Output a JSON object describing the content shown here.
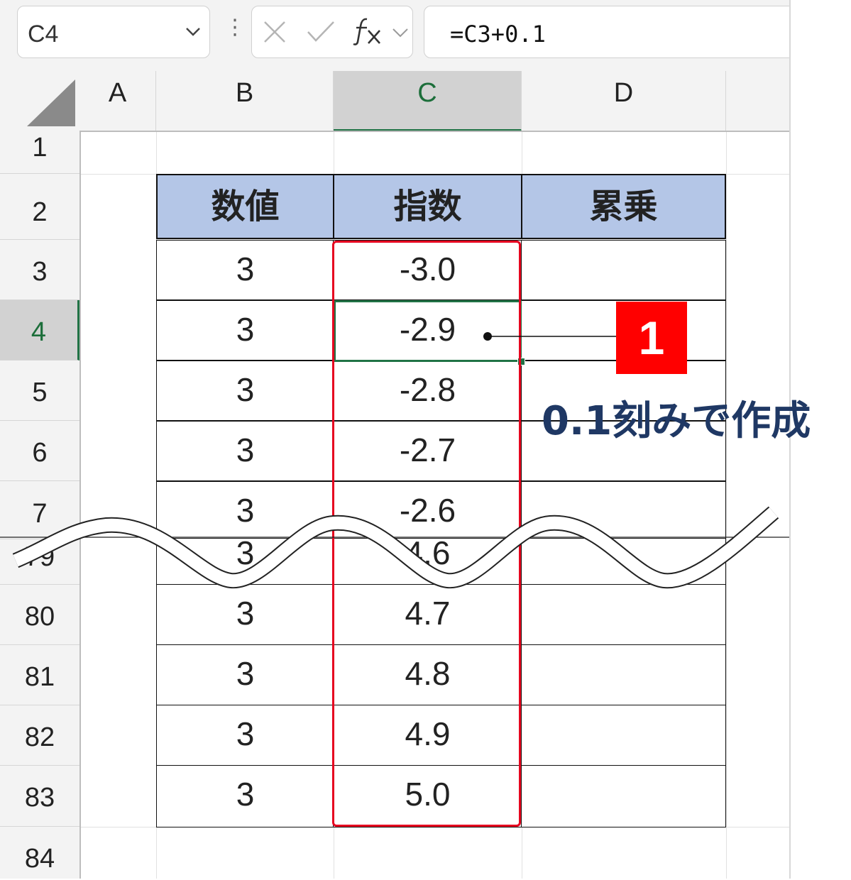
{
  "formula_bar": {
    "name_box": "C4",
    "formula": "=C3+0.1"
  },
  "columns": [
    "A",
    "B",
    "C",
    "D"
  ],
  "rows": [
    "1",
    "2",
    "3",
    "4",
    "5",
    "6",
    "7",
    "79",
    "80",
    "81",
    "82",
    "83",
    "84"
  ],
  "table": {
    "headers": [
      "数値",
      "指数",
      "累乗"
    ],
    "rows": [
      {
        "b": "3",
        "c": "-3.0",
        "d": ""
      },
      {
        "b": "3",
        "c": "-2.9",
        "d": ""
      },
      {
        "b": "3",
        "c": "-2.8",
        "d": ""
      },
      {
        "b": "3",
        "c": "-2.7",
        "d": ""
      },
      {
        "b": "3",
        "c": "-2.6",
        "d": ""
      },
      {
        "b": "3",
        "c": "4.6",
        "d": ""
      },
      {
        "b": "3",
        "c": "4.7",
        "d": ""
      },
      {
        "b": "3",
        "c": "4.8",
        "d": ""
      },
      {
        "b": "3",
        "c": "4.9",
        "d": ""
      },
      {
        "b": "3",
        "c": "5.0",
        "d": ""
      }
    ]
  },
  "annotation": {
    "badge": "1",
    "text": "0.1刻みで作成",
    "badge_color": "#ff0000",
    "text_color": "#1f3864",
    "highlight_color": "#e6001f"
  },
  "colors": {
    "header_fill": "#b4c6e7",
    "selection": "#217346"
  }
}
